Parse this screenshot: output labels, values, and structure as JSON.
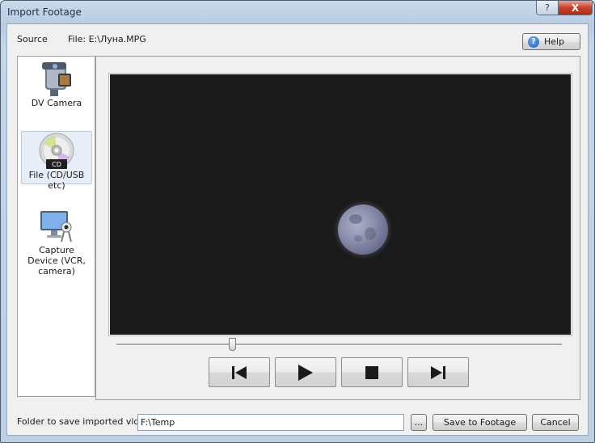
{
  "window": {
    "title": "Import Footage",
    "help_glyph": "?",
    "close_glyph": "X"
  },
  "header": {
    "source_label": "Source",
    "file_label": "File: E:\\Луна.MPG",
    "help_label": "Help"
  },
  "sources": [
    {
      "label": "DV Camera",
      "icon": "camcorder-icon",
      "selected": false
    },
    {
      "label": "File (CD/USB etc)",
      "icon": "cd-icon",
      "icon_text": "CD",
      "selected": true
    },
    {
      "label": "Capture Device (VCR, camera)",
      "icon": "capture-device-icon",
      "selected": false
    }
  ],
  "player": {
    "position_fraction": 0.26,
    "controls": [
      "skip-to-start-icon",
      "play-icon",
      "stop-icon",
      "skip-to-end-icon"
    ]
  },
  "footer": {
    "folder_label": "Folder to save imported video",
    "folder_value": "F:\\Temp",
    "browse_label": "...",
    "save_label": "Save to Footage",
    "cancel_label": "Cancel"
  },
  "colors": {
    "accent": "#1c5fbf",
    "close": "#c9402b",
    "video_bg": "#1a1a1a"
  }
}
